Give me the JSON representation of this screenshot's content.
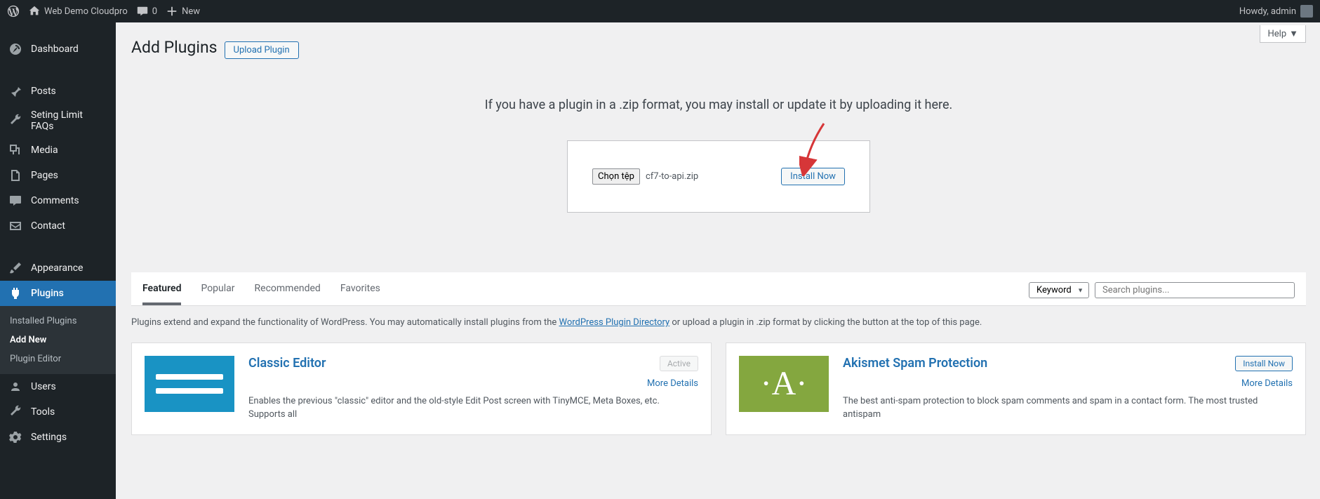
{
  "topbar": {
    "site_name": "Web Demo Cloudpro",
    "comments_count": "0",
    "new_label": "New",
    "howdy": "Howdy, admin"
  },
  "sidebar": {
    "dashboard": "Dashboard",
    "posts": "Posts",
    "faqs": "Seting Limit FAQs",
    "media": "Media",
    "pages": "Pages",
    "comments": "Comments",
    "contact": "Contact",
    "appearance": "Appearance",
    "plugins": "Plugins",
    "installed": "Installed Plugins",
    "addnew": "Add New",
    "editor": "Plugin Editor",
    "users": "Users",
    "tools": "Tools",
    "settings": "Settings"
  },
  "help_label": "Help",
  "header": {
    "title": "Add Plugins",
    "upload_button": "Upload Plugin"
  },
  "upload": {
    "instruction": "If you have a plugin in a .zip format, you may install or update it by uploading it here.",
    "choose_file": "Chọn tệp",
    "file_name": "cf7-to-api.zip",
    "install": "Install Now"
  },
  "tabs": {
    "featured": "Featured",
    "popular": "Popular",
    "recommended": "Recommended",
    "favorites": "Favorites"
  },
  "search": {
    "keyword": "Keyword",
    "placeholder": "Search plugins..."
  },
  "directory": {
    "prefix": "Plugins extend and expand the functionality of WordPress. You may automatically install plugins from the ",
    "link": "WordPress Plugin Directory",
    "suffix": " or upload a plugin in .zip format by clicking the button at the top of this page."
  },
  "cards": [
    {
      "title": "Classic Editor",
      "desc": "Enables the previous \"classic\" editor and the old-style Edit Post screen with TinyMCE, Meta Boxes, etc. Supports all",
      "action": "Active",
      "more": "More Details"
    },
    {
      "title": "Akismet Spam Protection",
      "desc": "The best anti-spam protection to block spam comments and spam in a contact form. The most trusted antispam",
      "action": "Install Now",
      "more": "More Details"
    }
  ]
}
